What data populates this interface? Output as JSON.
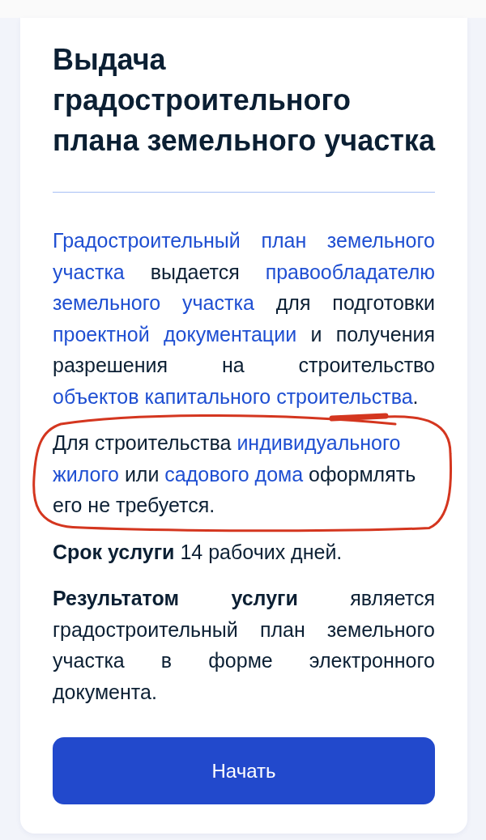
{
  "card": {
    "title": "Выдача градостроительного плана земельного участка",
    "paragraphs": [
      {
        "kind": "justified",
        "circled": false,
        "segments": [
          {
            "kind": "link",
            "text": "Градостроительный план земельного"
          },
          {
            "kind": "link",
            "text": "участка"
          },
          {
            "kind": "plain",
            "text": " выдается "
          },
          {
            "kind": "link",
            "text": "правообладателю"
          },
          {
            "kind": "link",
            "text": "земельного участка"
          },
          {
            "kind": "plain",
            "text": " для подготовки "
          },
          {
            "kind": "link",
            "text": "проектной документации"
          },
          {
            "kind": "plain",
            "text": " и получения разрешения на строительство "
          },
          {
            "kind": "link",
            "text": "объектов капитального строительства"
          },
          {
            "kind": "plain",
            "text": "."
          }
        ]
      },
      {
        "kind": "ragged",
        "circled": true,
        "segments": [
          {
            "kind": "plain",
            "text": "Для строительства "
          },
          {
            "kind": "link",
            "text": "индивидуального"
          },
          {
            "kind": "link",
            "text": "жилого"
          },
          {
            "kind": "plain",
            "text": " или "
          },
          {
            "kind": "link",
            "text": "садового дома"
          },
          {
            "kind": "plain",
            "text": " оформлять его не требуется."
          }
        ]
      },
      {
        "kind": "justified",
        "circled": false,
        "segments": [
          {
            "kind": "plain",
            "text": "**Срок услуги** 14 рабочих дней."
          }
        ]
      },
      {
        "kind": "justified",
        "circled": false,
        "segments": [
          {
            "kind": "plain",
            "text": "**Результатом услуги** является градостроительный план земельного участка в форме электронного документа."
          }
        ]
      }
    ],
    "button": {
      "label": "Начать"
    }
  }
}
